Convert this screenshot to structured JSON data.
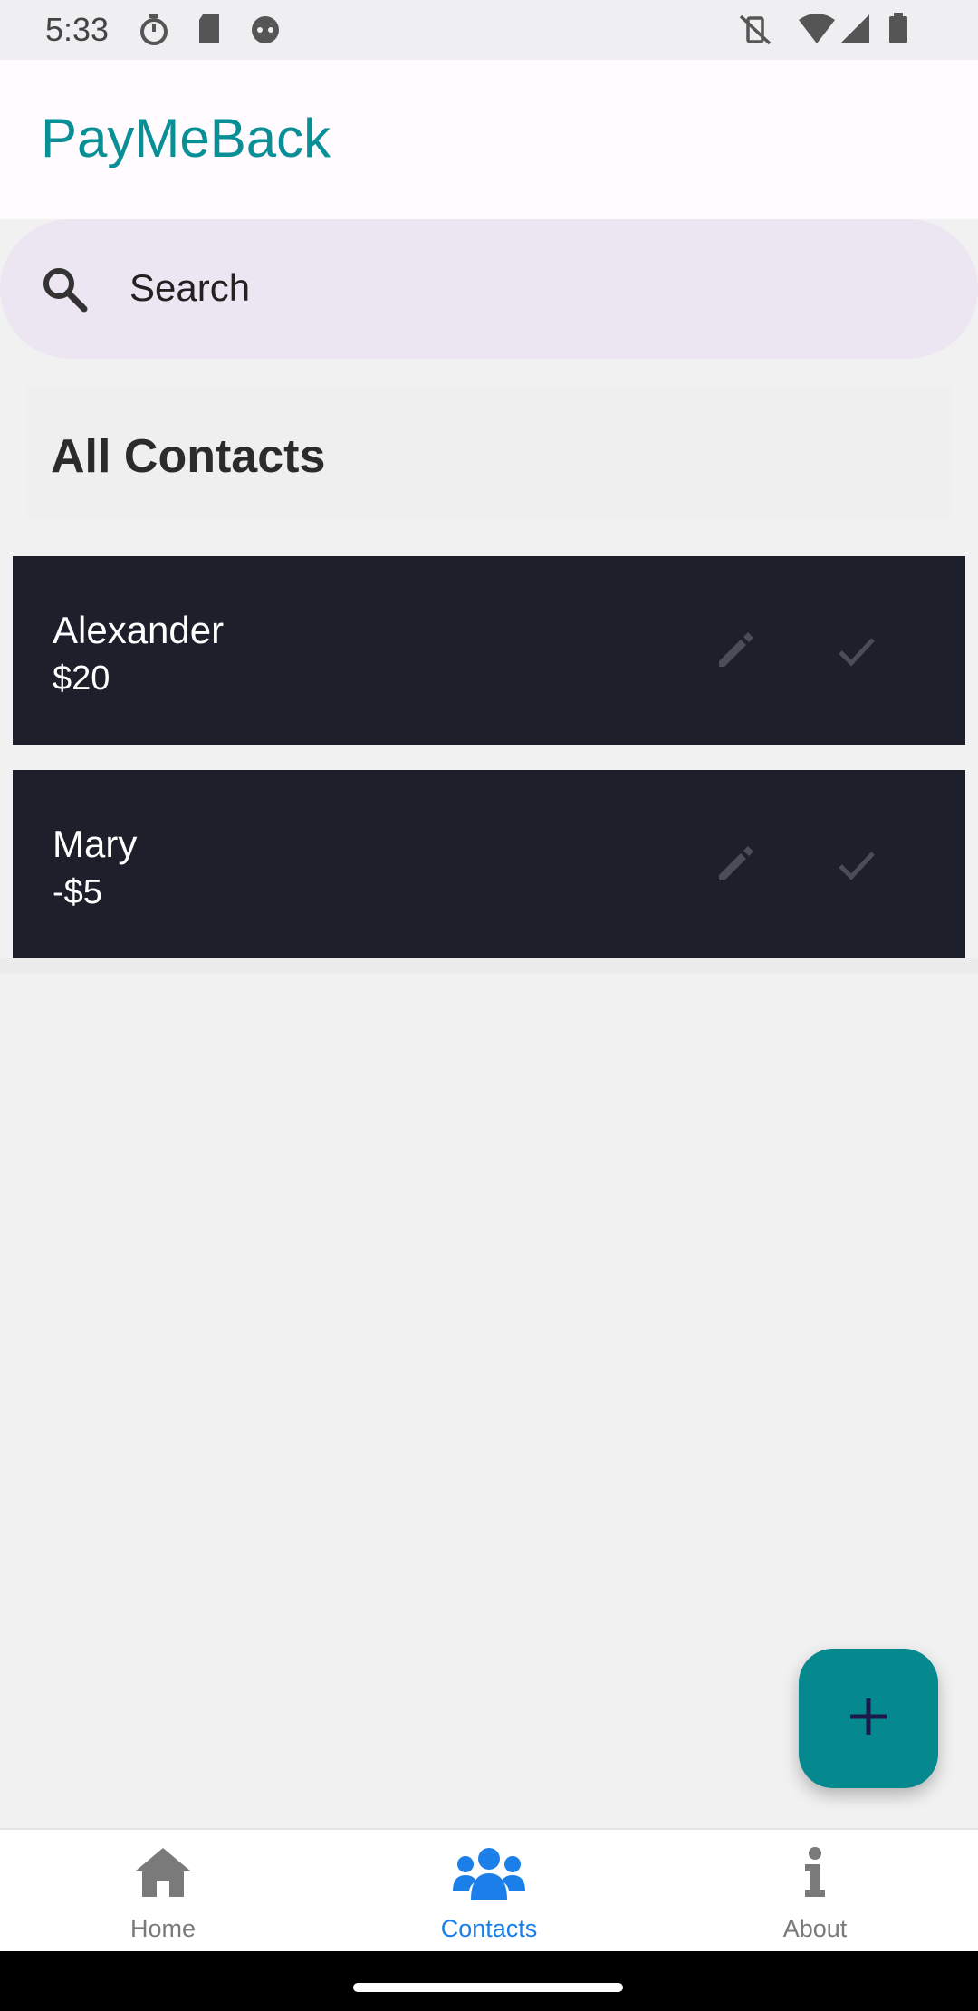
{
  "status_bar": {
    "time": "5:33"
  },
  "app_bar": {
    "title": "PayMeBack"
  },
  "search": {
    "placeholder": "Search"
  },
  "section": {
    "title": "All Contacts"
  },
  "contacts": [
    {
      "name": "Alexander",
      "amount": "$20"
    },
    {
      "name": "Mary",
      "amount": "-$5"
    }
  ],
  "bottom_nav": {
    "items": [
      {
        "label": "Home",
        "icon": "home-icon",
        "active": false
      },
      {
        "label": "Contacts",
        "icon": "contacts-icon",
        "active": true
      },
      {
        "label": "About",
        "icon": "info-icon",
        "active": false
      }
    ]
  },
  "colors": {
    "accent": "#098f96",
    "card_bg": "#1d1f2a",
    "active_nav": "#1a7fe8",
    "fab": "#06888f"
  }
}
